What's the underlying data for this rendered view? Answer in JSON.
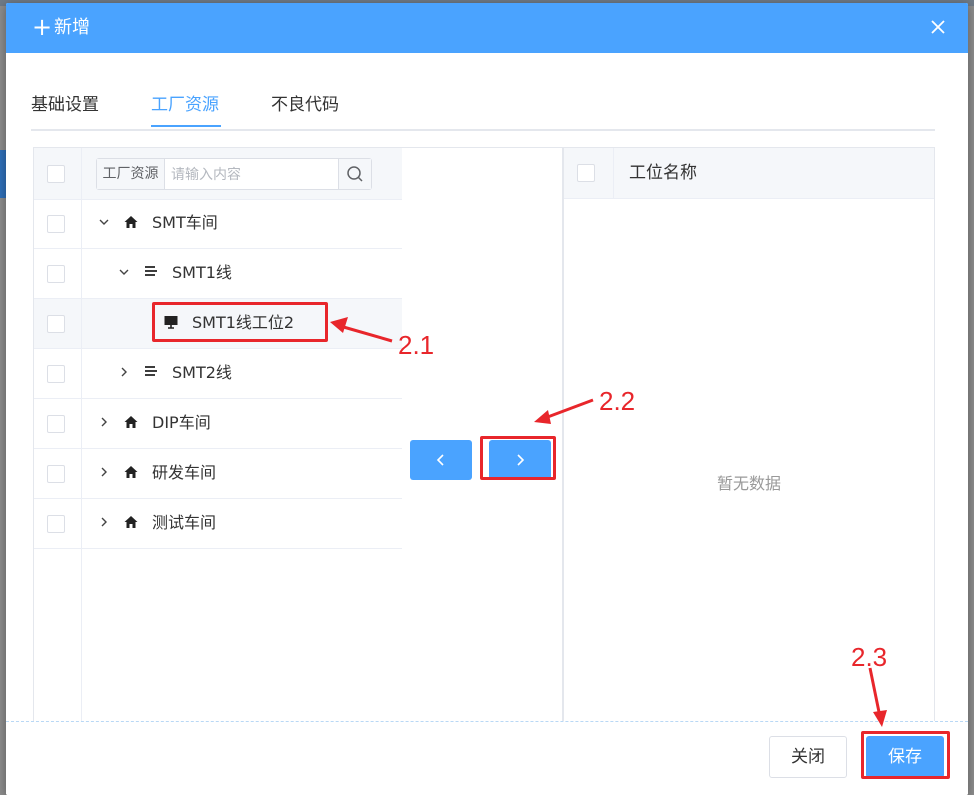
{
  "dialog": {
    "title": "新增",
    "plus_icon": "+",
    "close_icon": "close-icon"
  },
  "tabs": [
    {
      "label": "基础设置",
      "active": false
    },
    {
      "label": "工厂资源",
      "active": true
    },
    {
      "label": "不良代码",
      "active": false
    }
  ],
  "left_panel": {
    "search_prefix": "工厂资源",
    "search_placeholder": "请输入内容",
    "search_icon": "search-icon",
    "tree": [
      {
        "label": "SMT车间",
        "icon": "home-icon",
        "expanded": true
      },
      {
        "label": "SMT1线",
        "icon": "line-icon",
        "expanded": true
      },
      {
        "label": "SMT1线工位2",
        "icon": "monitor-icon",
        "selected": true
      },
      {
        "label": "SMT2线",
        "icon": "line-icon",
        "expanded": false
      },
      {
        "label": "DIP车间",
        "icon": "home-icon",
        "expanded": false
      },
      {
        "label": "研发车间",
        "icon": "home-icon",
        "expanded": false
      },
      {
        "label": "测试车间",
        "icon": "home-icon",
        "expanded": false
      }
    ]
  },
  "transfer": {
    "left_icon": "chevron-left-icon",
    "right_icon": "chevron-right-icon"
  },
  "right_panel": {
    "column": "工位名称",
    "empty_text": "暂无数据"
  },
  "footer": {
    "close_label": "关闭",
    "save_label": "保存"
  },
  "annotations": {
    "a1": "2.1",
    "a2": "2.2",
    "a3": "2.3",
    "color": "#e8262b"
  },
  "colors": {
    "primary": "#4aa3ff",
    "annotation": "#e8262b"
  }
}
